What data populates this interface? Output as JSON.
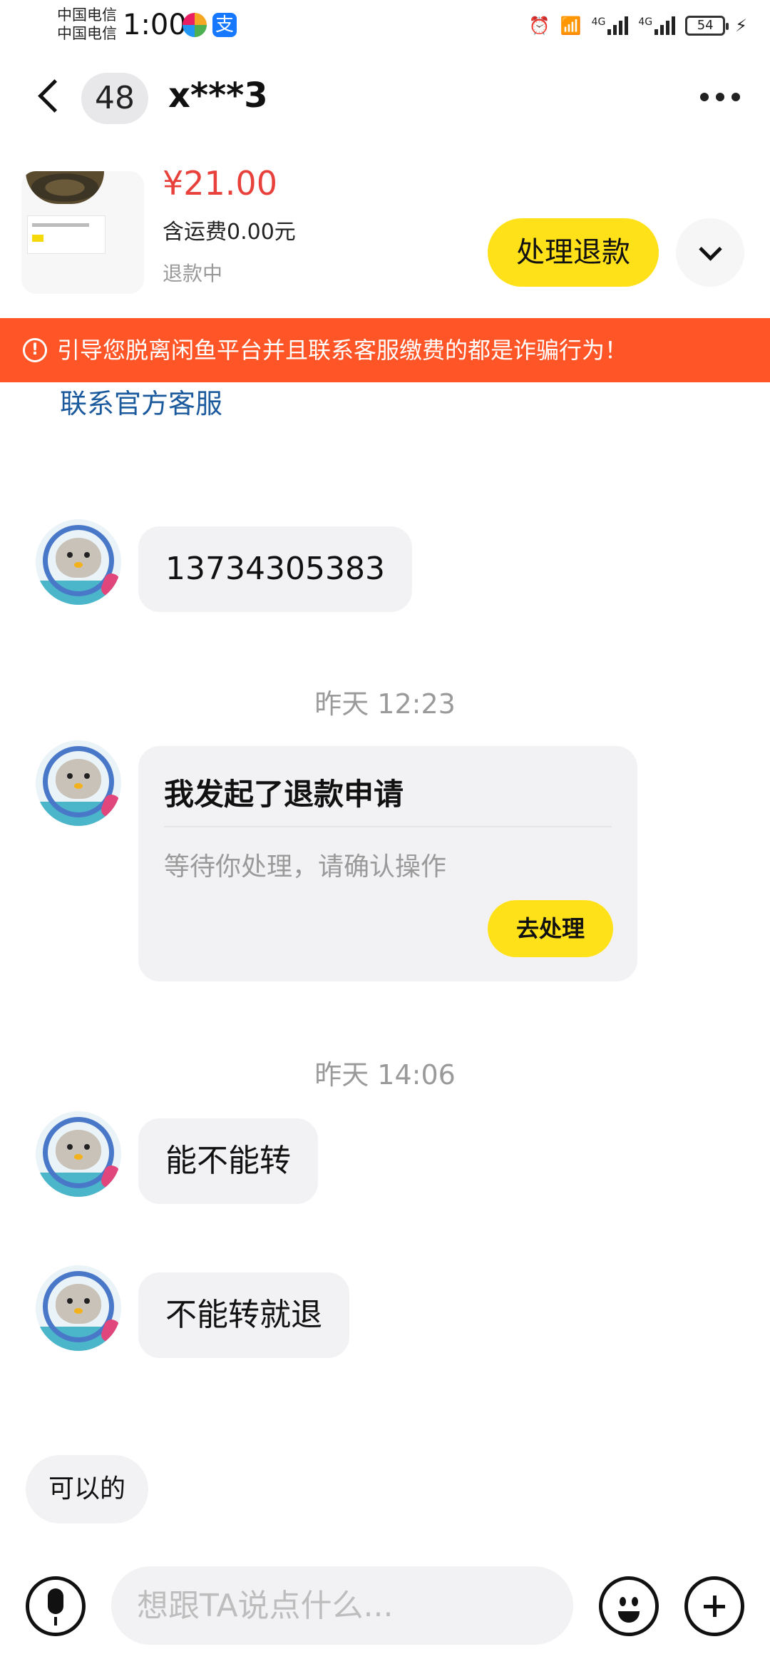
{
  "status_bar": {
    "carrier_line1": "中国电信",
    "carrier_line2": "中国电信",
    "time": "1:00",
    "network_1": "4G",
    "network_2": "4G",
    "battery": "54"
  },
  "header": {
    "unread_count": "48",
    "contact_name": "x***3"
  },
  "product": {
    "price": "¥21.00",
    "shipping": "含运费0.00元",
    "status": "退款中",
    "action_label": "处理退款"
  },
  "warning": {
    "text": "引导您脱离闲鱼平台并且联系客服缴费的都是诈骗行为！"
  },
  "service_link": "联系官方客服",
  "messages": {
    "msg1": "13734305383",
    "time1": "昨天 12:23",
    "refund_card": {
      "title": "我发起了退款申请",
      "subtitle": "等待你处理，请确认操作",
      "button": "去处理"
    },
    "time2": "昨天 14:06",
    "msg2": "能不能转",
    "msg3": "不能转就退"
  },
  "quick_reply": "可以的",
  "input": {
    "placeholder": "想跟TA说点什么..."
  },
  "colors": {
    "accent_yellow": "#ffe119",
    "price_red": "#e8413b",
    "warning_orange": "#ff5527",
    "link_blue": "#1c5a9e"
  }
}
